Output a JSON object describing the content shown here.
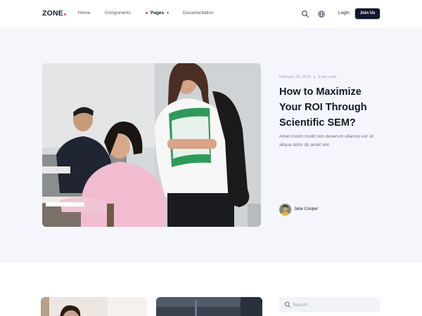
{
  "header": {
    "logo": "ZONE",
    "nav": [
      "Home",
      "Components",
      "Pages",
      "Documentation"
    ],
    "login": "Login",
    "join": "Join Us"
  },
  "hero": {
    "meta_date": "February 28, 2018",
    "meta_read": "6 min read",
    "title": "How to Maximize Your ROI Through Scientific SEM?",
    "excerpt": "Amet minim mollit non deserunt ullamco est sit aliqua dolor do amet sint.",
    "author": "Jane Cooper"
  },
  "search": {
    "placeholder": "Search..."
  },
  "icons": {
    "search": "search-icon",
    "language": "globe-icon",
    "dropdown": "chevron-down-icon"
  },
  "colors": {
    "accent": "#ef4444",
    "primary_dark": "#0f172a",
    "hero_bg": "#f4f6fb"
  }
}
